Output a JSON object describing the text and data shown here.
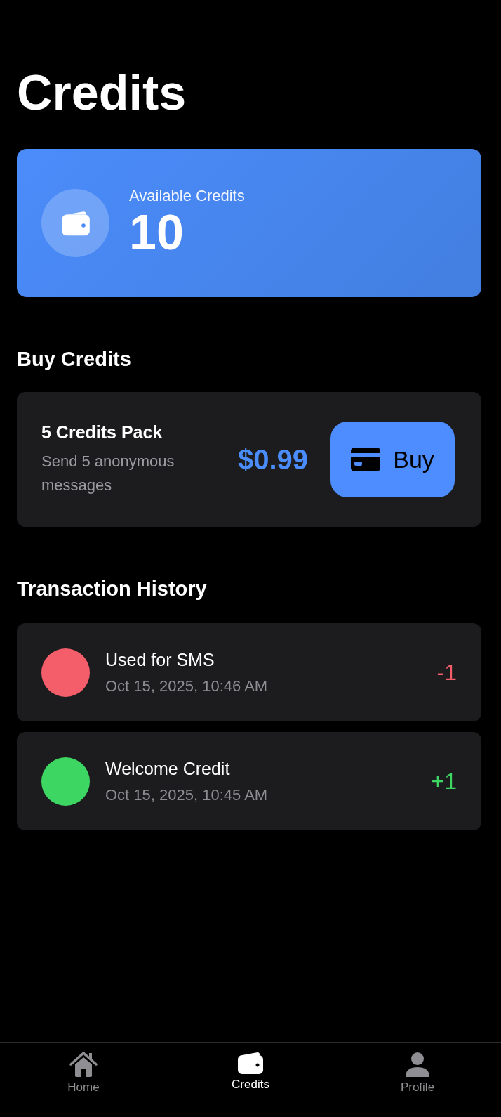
{
  "title": "Credits",
  "balance": {
    "label": "Available Credits",
    "value": "10"
  },
  "buy_section": {
    "heading": "Buy Credits",
    "pack": {
      "name": "5 Credits Pack",
      "description": "Send 5 anonymous messages",
      "price": "$0.99",
      "button": "Buy"
    }
  },
  "history": {
    "heading": "Transaction History",
    "transactions": [
      {
        "title": "Used for SMS",
        "date": "Oct 15, 2025, 10:46 AM",
        "amount": "-1",
        "color": "#f45d6a"
      },
      {
        "title": "Welcome Credit",
        "date": "Oct 15, 2025, 10:45 AM",
        "amount": "+1",
        "color": "#3ed663"
      }
    ]
  },
  "tab_bar": [
    {
      "label": "Home",
      "kind": "home",
      "selected": false
    },
    {
      "label": "Credits",
      "kind": "wallet",
      "selected": true
    },
    {
      "label": "Profile",
      "kind": "person",
      "selected": false
    }
  ]
}
